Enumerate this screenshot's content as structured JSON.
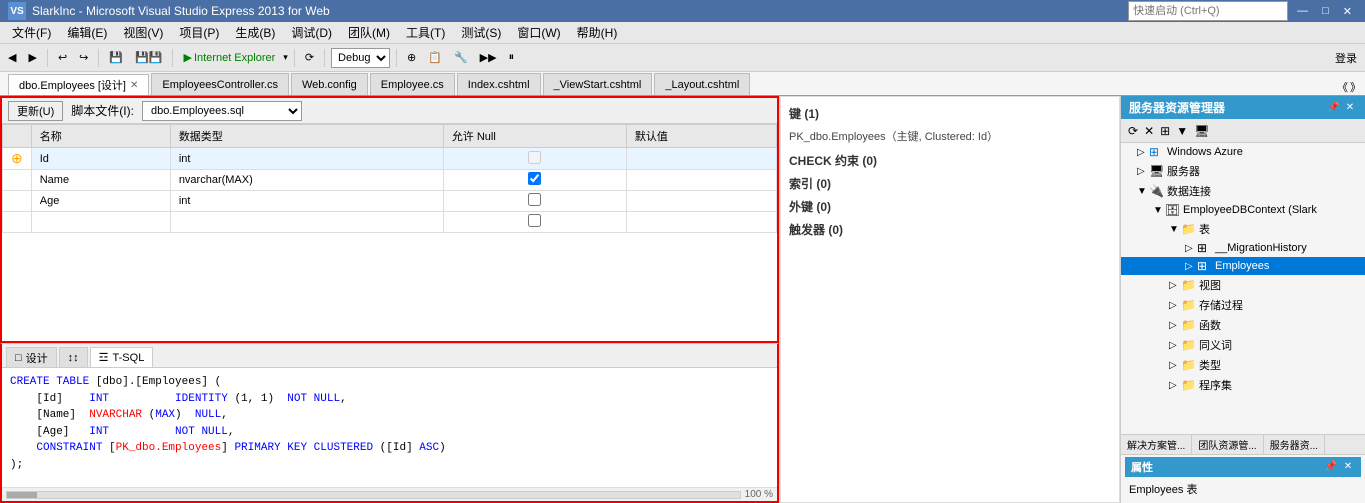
{
  "titleBar": {
    "logoText": "VS",
    "title": "SlarkInc - Microsoft Visual Studio Express 2013 for Web",
    "quickLaunchPlaceholder": "快速启动 (Ctrl+Q)",
    "minimizeLabel": "—",
    "maximizeLabel": "□",
    "closeLabel": "✕"
  },
  "menuBar": {
    "items": [
      "文件(F)",
      "编辑(E)",
      "视图(V)",
      "项目(P)",
      "生成(B)",
      "调试(D)",
      "团队(M)",
      "工具(T)",
      "测试(S)",
      "窗口(W)",
      "帮助(H)"
    ]
  },
  "toolbar": {
    "backLabel": "◀",
    "forwardLabel": "▶",
    "browserLabel": "Internet Explorer",
    "browserArrow": "▾",
    "refreshLabel": "⟳",
    "debugLabel": "Debug",
    "debugArrow": "▾",
    "loginLabel": "登录"
  },
  "tabs": {
    "items": [
      {
        "label": "dbo.Employees [设计]",
        "active": true,
        "closable": true
      },
      {
        "label": "EmployeesController.cs",
        "active": false,
        "closable": false
      },
      {
        "label": "Web.config",
        "active": false,
        "closable": false
      },
      {
        "label": "Employee.cs",
        "active": false,
        "closable": false
      },
      {
        "label": "Index.cshtml",
        "active": false,
        "closable": false
      },
      {
        "label": "_ViewStart.cshtml",
        "active": false,
        "closable": false
      },
      {
        "label": "_Layout.cshtml",
        "active": false,
        "closable": false
      }
    ],
    "scrollLeft": "《",
    "scrollRight": "》"
  },
  "designEditor": {
    "updateBtn": "更新(U)",
    "scriptLabel": "脚本文件(I):",
    "scriptValue": "dbo.Employees.sql",
    "columns": {
      "headers": [
        "名称",
        "数据类型",
        "允许 Null",
        "默认值"
      ],
      "rows": [
        {
          "isKey": true,
          "keySymbol": "⊕",
          "name": "Id",
          "type": "int",
          "nullable": false,
          "default": ""
        },
        {
          "isKey": false,
          "name": "Name",
          "type": "nvarchar(MAX)",
          "nullable": true,
          "default": ""
        },
        {
          "isKey": false,
          "name": "Age",
          "type": "int",
          "nullable": false,
          "default": ""
        },
        {
          "isKey": false,
          "name": "",
          "type": "",
          "nullable": false,
          "default": ""
        }
      ]
    }
  },
  "propertiesPanel": {
    "sections": [
      {
        "title": "键 (1)",
        "items": [
          "PK_dbo.Employees（主键, Clustered: Id）"
        ]
      },
      {
        "title": "CHECK 约束 (0)",
        "items": []
      },
      {
        "title": "索引 (0)",
        "items": []
      },
      {
        "title": "外键 (0)",
        "items": []
      },
      {
        "title": "触发器 (0)",
        "items": []
      }
    ]
  },
  "sqlPanel": {
    "tabs": [
      {
        "label": "□ 设计",
        "active": false
      },
      {
        "label": "↕↕",
        "active": false
      },
      {
        "label": "☲ T-SQL",
        "active": true
      }
    ],
    "code": [
      {
        "indent": 0,
        "text": "CREATE TABLE [dbo].[Employees] (",
        "type": "mixed",
        "parts": [
          {
            "t": "kw",
            "v": "CREATE TABLE"
          },
          {
            "t": "normal",
            "v": " [dbo].[Employees] ("
          }
        ]
      },
      {
        "indent": 1,
        "text": "[Id]    INT          IDENTITY (1, 1)  NOT NULL,",
        "type": "mixed",
        "parts": [
          {
            "t": "normal",
            "v": "    [Id]    "
          },
          {
            "t": "kw",
            "v": "INT"
          },
          {
            "t": "normal",
            "v": "          "
          },
          {
            "t": "kw",
            "v": "IDENTITY"
          },
          {
            "t": "normal",
            "v": " (1, 1)  "
          },
          {
            "t": "kw",
            "v": "NOT NULL"
          },
          {
            "t": "normal",
            "v": ","
          }
        ]
      },
      {
        "indent": 1,
        "text": "[Name]  NVARCHAR (MAX)  NULL,",
        "type": "mixed",
        "parts": [
          {
            "t": "normal",
            "v": "    [Name]  "
          },
          {
            "t": "kw",
            "v": "NVARCHAR"
          },
          {
            "t": "normal",
            "v": " ("
          },
          {
            "t": "kw",
            "v": "MAX"
          },
          {
            "t": "normal",
            "v": ")  "
          },
          {
            "t": "kw",
            "v": "NULL"
          },
          {
            "t": "normal",
            "v": ","
          }
        ]
      },
      {
        "indent": 1,
        "text": "[Age]   INT          NOT NULL,",
        "type": "mixed",
        "parts": [
          {
            "t": "normal",
            "v": "    [Age]   "
          },
          {
            "t": "kw",
            "v": "INT"
          },
          {
            "t": "normal",
            "v": "          "
          },
          {
            "t": "kw",
            "v": "NOT NULL"
          },
          {
            "t": "normal",
            "v": ","
          }
        ]
      },
      {
        "indent": 1,
        "text": "CONSTRAINT [PK_dbo.Employees] PRIMARY KEY CLUSTERED ([Id] ASC)",
        "type": "mixed",
        "parts": [
          {
            "t": "normal",
            "v": "    "
          },
          {
            "t": "kw",
            "v": "CONSTRAINT"
          },
          {
            "t": "normal",
            "v": " ["
          },
          {
            "t": "constraint",
            "v": "PK_dbo.Employees"
          },
          {
            "t": "normal",
            "v": "] "
          },
          {
            "t": "kw",
            "v": "PRIMARY KEY CLUSTERED"
          },
          {
            "t": "normal",
            "v": " ([Id] "
          },
          {
            "t": "kw",
            "v": "ASC"
          },
          {
            "t": "normal",
            "v": ")"
          }
        ]
      },
      {
        "indent": 0,
        "text": ");",
        "type": "normal",
        "parts": [
          {
            "t": "normal",
            "v": ");"
          }
        ]
      }
    ],
    "percentLabel": "100 %"
  },
  "serverExplorer": {
    "title": "服务器资源管理器",
    "pinLabel": "📌",
    "closeLabel": "✕",
    "tree": [
      {
        "level": 0,
        "expanded": true,
        "icon": "⊞",
        "iconColor": "#0078d7",
        "label": "Windows Azure"
      },
      {
        "level": 0,
        "expanded": false,
        "icon": "🖥",
        "iconColor": "#555",
        "label": "服务器"
      },
      {
        "level": 0,
        "expanded": true,
        "icon": "🔌",
        "iconColor": "#555",
        "label": "数据连接"
      },
      {
        "level": 1,
        "expanded": true,
        "icon": "🗄",
        "iconColor": "#555",
        "label": "EmployeeDBContext (Slark"
      },
      {
        "level": 2,
        "expanded": true,
        "icon": "📁",
        "iconColor": "#e8a000",
        "label": "表"
      },
      {
        "level": 3,
        "expanded": false,
        "icon": "⊞",
        "iconColor": "#555",
        "label": "__MigrationHistory"
      },
      {
        "level": 3,
        "expanded": true,
        "icon": "⊞",
        "iconColor": "#555",
        "label": "Employees",
        "selected": true
      },
      {
        "level": 2,
        "expanded": false,
        "icon": "📁",
        "iconColor": "#e8a000",
        "label": "视图"
      },
      {
        "level": 2,
        "expanded": false,
        "icon": "📁",
        "iconColor": "#e8a000",
        "label": "存储过程"
      },
      {
        "level": 2,
        "expanded": false,
        "icon": "📁",
        "iconColor": "#e8a000",
        "label": "函数"
      },
      {
        "level": 2,
        "expanded": false,
        "icon": "📁",
        "iconColor": "#e8a000",
        "label": "同义词"
      },
      {
        "level": 2,
        "expanded": false,
        "icon": "📁",
        "iconColor": "#e8a000",
        "label": "类型"
      },
      {
        "level": 2,
        "expanded": false,
        "icon": "📁",
        "iconColor": "#e8a000",
        "label": "程序集"
      }
    ],
    "bottomTabs": [
      "解决方案管...",
      "团队资源管...",
      "服务器资..."
    ],
    "propertiesTitle": "属性",
    "propertiesValue": "Employees 表"
  }
}
